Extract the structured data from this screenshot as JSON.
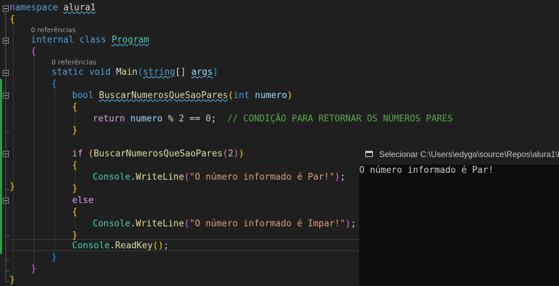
{
  "editor": {
    "codelens_refs": [
      "0 referências",
      "0 referências"
    ],
    "code": {
      "l1_kw": "namespace",
      "l1_name": "alura1",
      "l3_kw1": "internal",
      "l3_kw2": "class",
      "l3_name": "Program",
      "l5_kw1": "static",
      "l5_kw2": "void",
      "l5_fn": "Main",
      "l5_type": "string",
      "l5_arr": "[]",
      "l5_param": "args",
      "l7_type": "bool",
      "l7_fn": "BuscarNumerosQueSaoPares",
      "l7_ptype": "int",
      "l7_param": "numero",
      "l9_kw": "return",
      "l9_var": "numero",
      "l9_op": " % ",
      "l9_num1": "2",
      "l9_eq": " == ",
      "l9_num2": "0",
      "l9_comment": "// CONDIÇÃO PARA RETORNAR OS NÚMEROS PARES",
      "l12_kw": "if",
      "l12_fn": "BuscarNumerosQueSaoPares",
      "l12_num": "2",
      "l14_cls": "Console",
      "l14_fn": "WriteLine",
      "l14_str": "\"O número informado é Par!\"",
      "l17_kw": "else",
      "l19_cls": "Console",
      "l19_fn": "WriteLine",
      "l19_str": "\"O número informado é Impar!\"",
      "l21_cls": "Console",
      "l21_fn": "ReadKey"
    }
  },
  "console": {
    "title": "Selecionar C:\\Users\\edyga\\source\\Repos\\alura1\\b",
    "output": "O número informado é Par!"
  }
}
